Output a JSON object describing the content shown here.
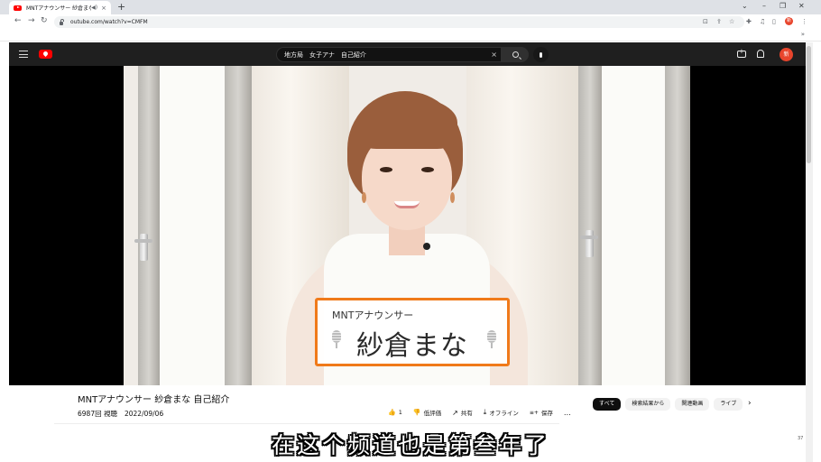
{
  "browser": {
    "tab": {
      "title": "MNTアナウンサー 紗倉まな",
      "audio_icon": "speaker-icon",
      "close": "×"
    },
    "new_tab": "+",
    "window_controls": {
      "collapse": "⌄",
      "minimize": "–",
      "restore": "❐",
      "close": "✕"
    },
    "nav": {
      "back": "←",
      "forward": "→",
      "reload": "↻"
    },
    "url": "outube.com/watch?v=CMFM",
    "toolbar_icons": [
      "install-icon",
      "share-icon",
      "star-icon",
      "extensions-icon",
      "media-icon",
      "sidepanel-icon"
    ],
    "profile_initial": "新",
    "menu": "⋮",
    "bookmarks_overflow": "»"
  },
  "youtube": {
    "search_query": "地方局　女子アナ　自己紹介",
    "search_clear": "×",
    "avatar_initial": "新",
    "colors": {
      "masthead": "#1f1f1f",
      "brand_red": "#ff0000",
      "accent_orange": "#f07a1a"
    }
  },
  "video": {
    "overlay_caption_title": "MNTアナウンサー",
    "overlay_caption_name": "紗倉まな"
  },
  "watch": {
    "title": "MNTアナウンサー 紗倉まな 自己紹介",
    "views": "6987回 視聴",
    "date": "2022/09/06",
    "actions": {
      "like_icon": "👍",
      "like_count": "1",
      "dislike_icon": "👎",
      "dislike_label": "低評価",
      "share_icon": "↗",
      "share_label": "共有",
      "offline_icon": "⤓",
      "offline_label": "オフライン",
      "save_icon": "≡+",
      "save_label": "保存",
      "more": "…"
    },
    "chips": [
      "すべて",
      "検索結果から",
      "関連動画",
      "ライブ"
    ],
    "chips_next": "›"
  },
  "subtitle": "在这个频道也是第叁年了",
  "corner_label": "37"
}
